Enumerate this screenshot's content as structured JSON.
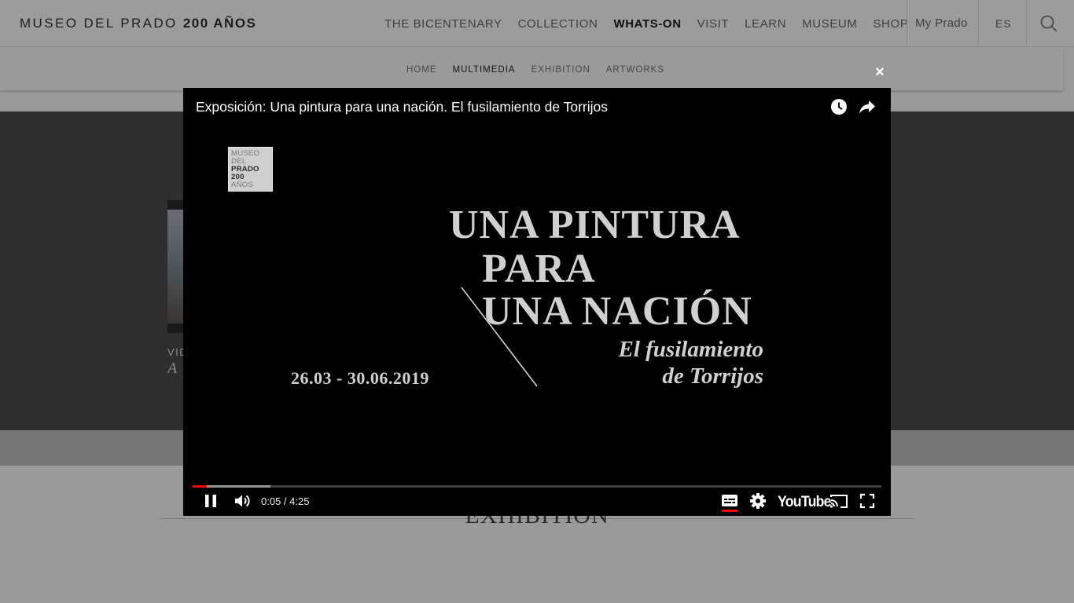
{
  "header": {
    "logo_main": "MUSEO DEL PRADO",
    "logo_bold": "200 AÑOS",
    "nav": [
      {
        "label": "THE BICENTENARY",
        "active": false
      },
      {
        "label": "COLLECTION",
        "active": false
      },
      {
        "label": "WHATS-ON",
        "active": true
      },
      {
        "label": "VISIT",
        "active": false
      },
      {
        "label": "LEARN",
        "active": false
      },
      {
        "label": "MUSEUM",
        "active": false
      },
      {
        "label": "SHOP",
        "active": false
      }
    ],
    "my_prado": "My Prado",
    "language": "ES"
  },
  "subnav": {
    "items": [
      {
        "label": "HOME",
        "active": false
      },
      {
        "label": "MULTIMEDIA",
        "active": true
      },
      {
        "label": "EXHIBITION",
        "active": false
      },
      {
        "label": "ARTWORKS",
        "active": false
      }
    ]
  },
  "background": {
    "card_type": "VIDEO",
    "card_title": "A",
    "section_heading": "EXHIBITION"
  },
  "modal": {
    "close_symbol": "×"
  },
  "player": {
    "title": "Exposición: Una pintura para una nación. El fusilamiento de Torrijos",
    "badge": [
      "MUSEO",
      "DEL",
      "PRADO",
      "200",
      "AÑOS"
    ],
    "title_card": {
      "line1": "UNA PINTURA",
      "line2": "PARA",
      "line3": "UNA NACIÓN",
      "subtitle1": "El fusilamiento",
      "subtitle2": "de Torrijos",
      "dates": "26.03 - 30.06.2019"
    },
    "time_current": "0:05",
    "time_separator": " / ",
    "time_total": "4:25",
    "played_fraction": 0.021,
    "buffered_fraction": 0.113,
    "youtube_label": "YouTube",
    "accent_color": "#ff0000"
  }
}
